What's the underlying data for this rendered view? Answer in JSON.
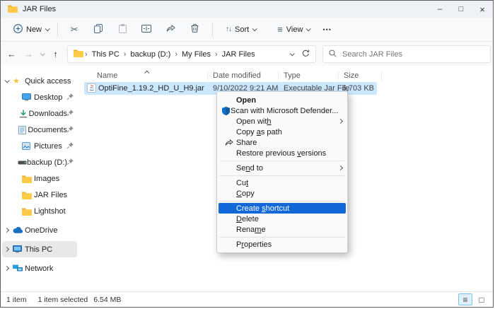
{
  "window": {
    "title": "JAR Files"
  },
  "icons": {
    "back": "←",
    "forward": "→",
    "up": "↑",
    "minimize": "–",
    "maximize": "□",
    "close": "×",
    "crumb_separator": "›",
    "scissors": "✂",
    "sort_glyph": "↑↓",
    "view_glyph": "≡",
    "more_glyph": "•••",
    "star": "★",
    "list_view_glyph": "≡",
    "icons_view_glyph": "□"
  },
  "colors": {
    "accent": "#1168d6",
    "selection_bg": "#cce8ff",
    "defender_blue": "#1170c8"
  },
  "toolbar": {
    "new_label": "New",
    "sort_label": "Sort",
    "view_label": "View"
  },
  "navbar": {
    "breadcrumbs": [
      "This PC",
      "backup (D:)",
      "My Files",
      "JAR Files"
    ],
    "search_placeholder": "Search JAR Files"
  },
  "sidebar": {
    "items": [
      {
        "label": "Quick access"
      },
      {
        "label": "Desktop"
      },
      {
        "label": "Downloads"
      },
      {
        "label": "Documents"
      },
      {
        "label": "Pictures"
      },
      {
        "label": "backup (D:)"
      },
      {
        "label": "Images"
      },
      {
        "label": "JAR Files"
      },
      {
        "label": "Lightshot"
      },
      {
        "label": "OneDrive"
      },
      {
        "label": "This PC"
      },
      {
        "label": "Network"
      }
    ]
  },
  "main": {
    "columns": [
      "Name",
      "Date modified",
      "Type",
      "Size"
    ],
    "file": {
      "name": "OptiFine_1.19.2_HD_U_H9.jar",
      "date": "9/10/2022 9:21 AM",
      "type": "Executable Jar File",
      "size": "6,703 KB"
    }
  },
  "context_menu": {
    "items": [
      {
        "pre": "Open",
        "key": "",
        "post": ""
      },
      {
        "pre": "Scan with Microsoft Defender...",
        "key": "",
        "post": ""
      },
      {
        "pre": "Open wit",
        "key": "h",
        "post": ""
      },
      {
        "pre": "Copy ",
        "key": "a",
        "post": "s path"
      },
      {
        "pre": "Share",
        "key": "",
        "post": ""
      },
      {
        "pre": "Restore previous ",
        "key": "v",
        "post": "ersions"
      },
      {
        "pre": "Se",
        "key": "n",
        "post": "d to"
      },
      {
        "pre": "Cu",
        "key": "t",
        "post": ""
      },
      {
        "pre": "",
        "key": "C",
        "post": "opy"
      },
      {
        "pre": "Create ",
        "key": "s",
        "post": "hortcut"
      },
      {
        "pre": "",
        "key": "D",
        "post": "elete"
      },
      {
        "pre": "Rena",
        "key": "m",
        "post": "e"
      },
      {
        "pre": "P",
        "key": "r",
        "post": "operties"
      }
    ]
  },
  "statusbar": {
    "items_count": "1 item",
    "selection": "1 item selected",
    "selection_size": "6.54 MB"
  }
}
